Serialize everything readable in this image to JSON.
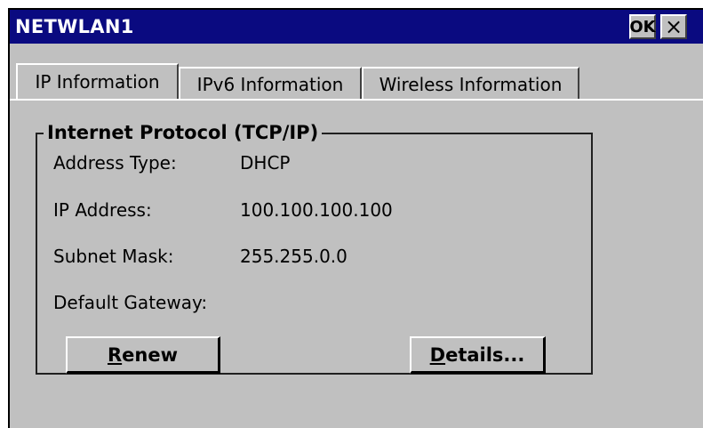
{
  "window": {
    "title": "NETWLAN1",
    "ok_label": "OK",
    "close_label": "×"
  },
  "tabs": [
    {
      "label": "IP Information"
    },
    {
      "label": "IPv6 Information"
    },
    {
      "label": "Wireless Information"
    }
  ],
  "group": {
    "title": "Internet Protocol (TCP/IP)"
  },
  "fields": [
    {
      "label": "Address Type:",
      "value": "DHCP"
    },
    {
      "label": "IP Address:",
      "value": "100.100.100.100"
    },
    {
      "label": "Subnet Mask:",
      "value": "255.255.0.0"
    },
    {
      "label": "Default Gateway:",
      "value": ""
    }
  ],
  "buttons": {
    "renew_first": "R",
    "renew_rest": "enew",
    "details_first": "D",
    "details_rest": "etails..."
  },
  "colors": {
    "titlebar": "#0a0a80",
    "face": "#c0c0c0"
  }
}
